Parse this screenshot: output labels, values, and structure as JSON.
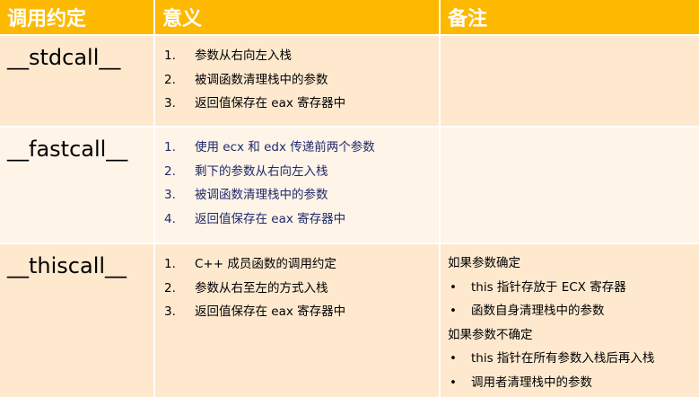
{
  "headers": [
    "调用约定",
    "意义",
    "备注"
  ],
  "rows": [
    {
      "name": "__stdcall__",
      "points": [
        "参数从右向左入栈",
        "被调函数清理栈中的参数",
        "返回值保存在 eax 寄存器中"
      ],
      "notes": []
    },
    {
      "name": "__fastcall__",
      "points": [
        "使用 ecx 和 edx 传递前两个参数",
        "剩下的参数从右向左入栈",
        "被调函数清理栈中的参数",
        "返回值保存在 eax 寄存器中"
      ],
      "notes": []
    },
    {
      "name": "__thiscall__",
      "points": [
        "C++ 成员函数的调用约定",
        "参数从右至左的方式入栈",
        "返回值保存在 eax 寄存器中"
      ],
      "notes": [
        {
          "type": "text",
          "text": "如果参数确定"
        },
        {
          "type": "bullet",
          "text": "this 指针存放于 ECX 寄存器"
        },
        {
          "type": "bullet",
          "text": "函数自身清理栈中的参数"
        },
        {
          "type": "text",
          "text": "如果参数不确定"
        },
        {
          "type": "bullet",
          "text": "this 指针在所有参数入栈后再入栈"
        },
        {
          "type": "bullet",
          "text": "调用者清理栈中的参数"
        }
      ]
    }
  ],
  "list_numbers": [
    "1.",
    "2.",
    "3.",
    "4."
  ],
  "bullet_symbol": "•",
  "colors": {
    "header_bg": "#FDB900",
    "row_dark": "#FEE9CF",
    "row_light": "#FEF4E8",
    "navy_text": "#1F2A6B"
  }
}
